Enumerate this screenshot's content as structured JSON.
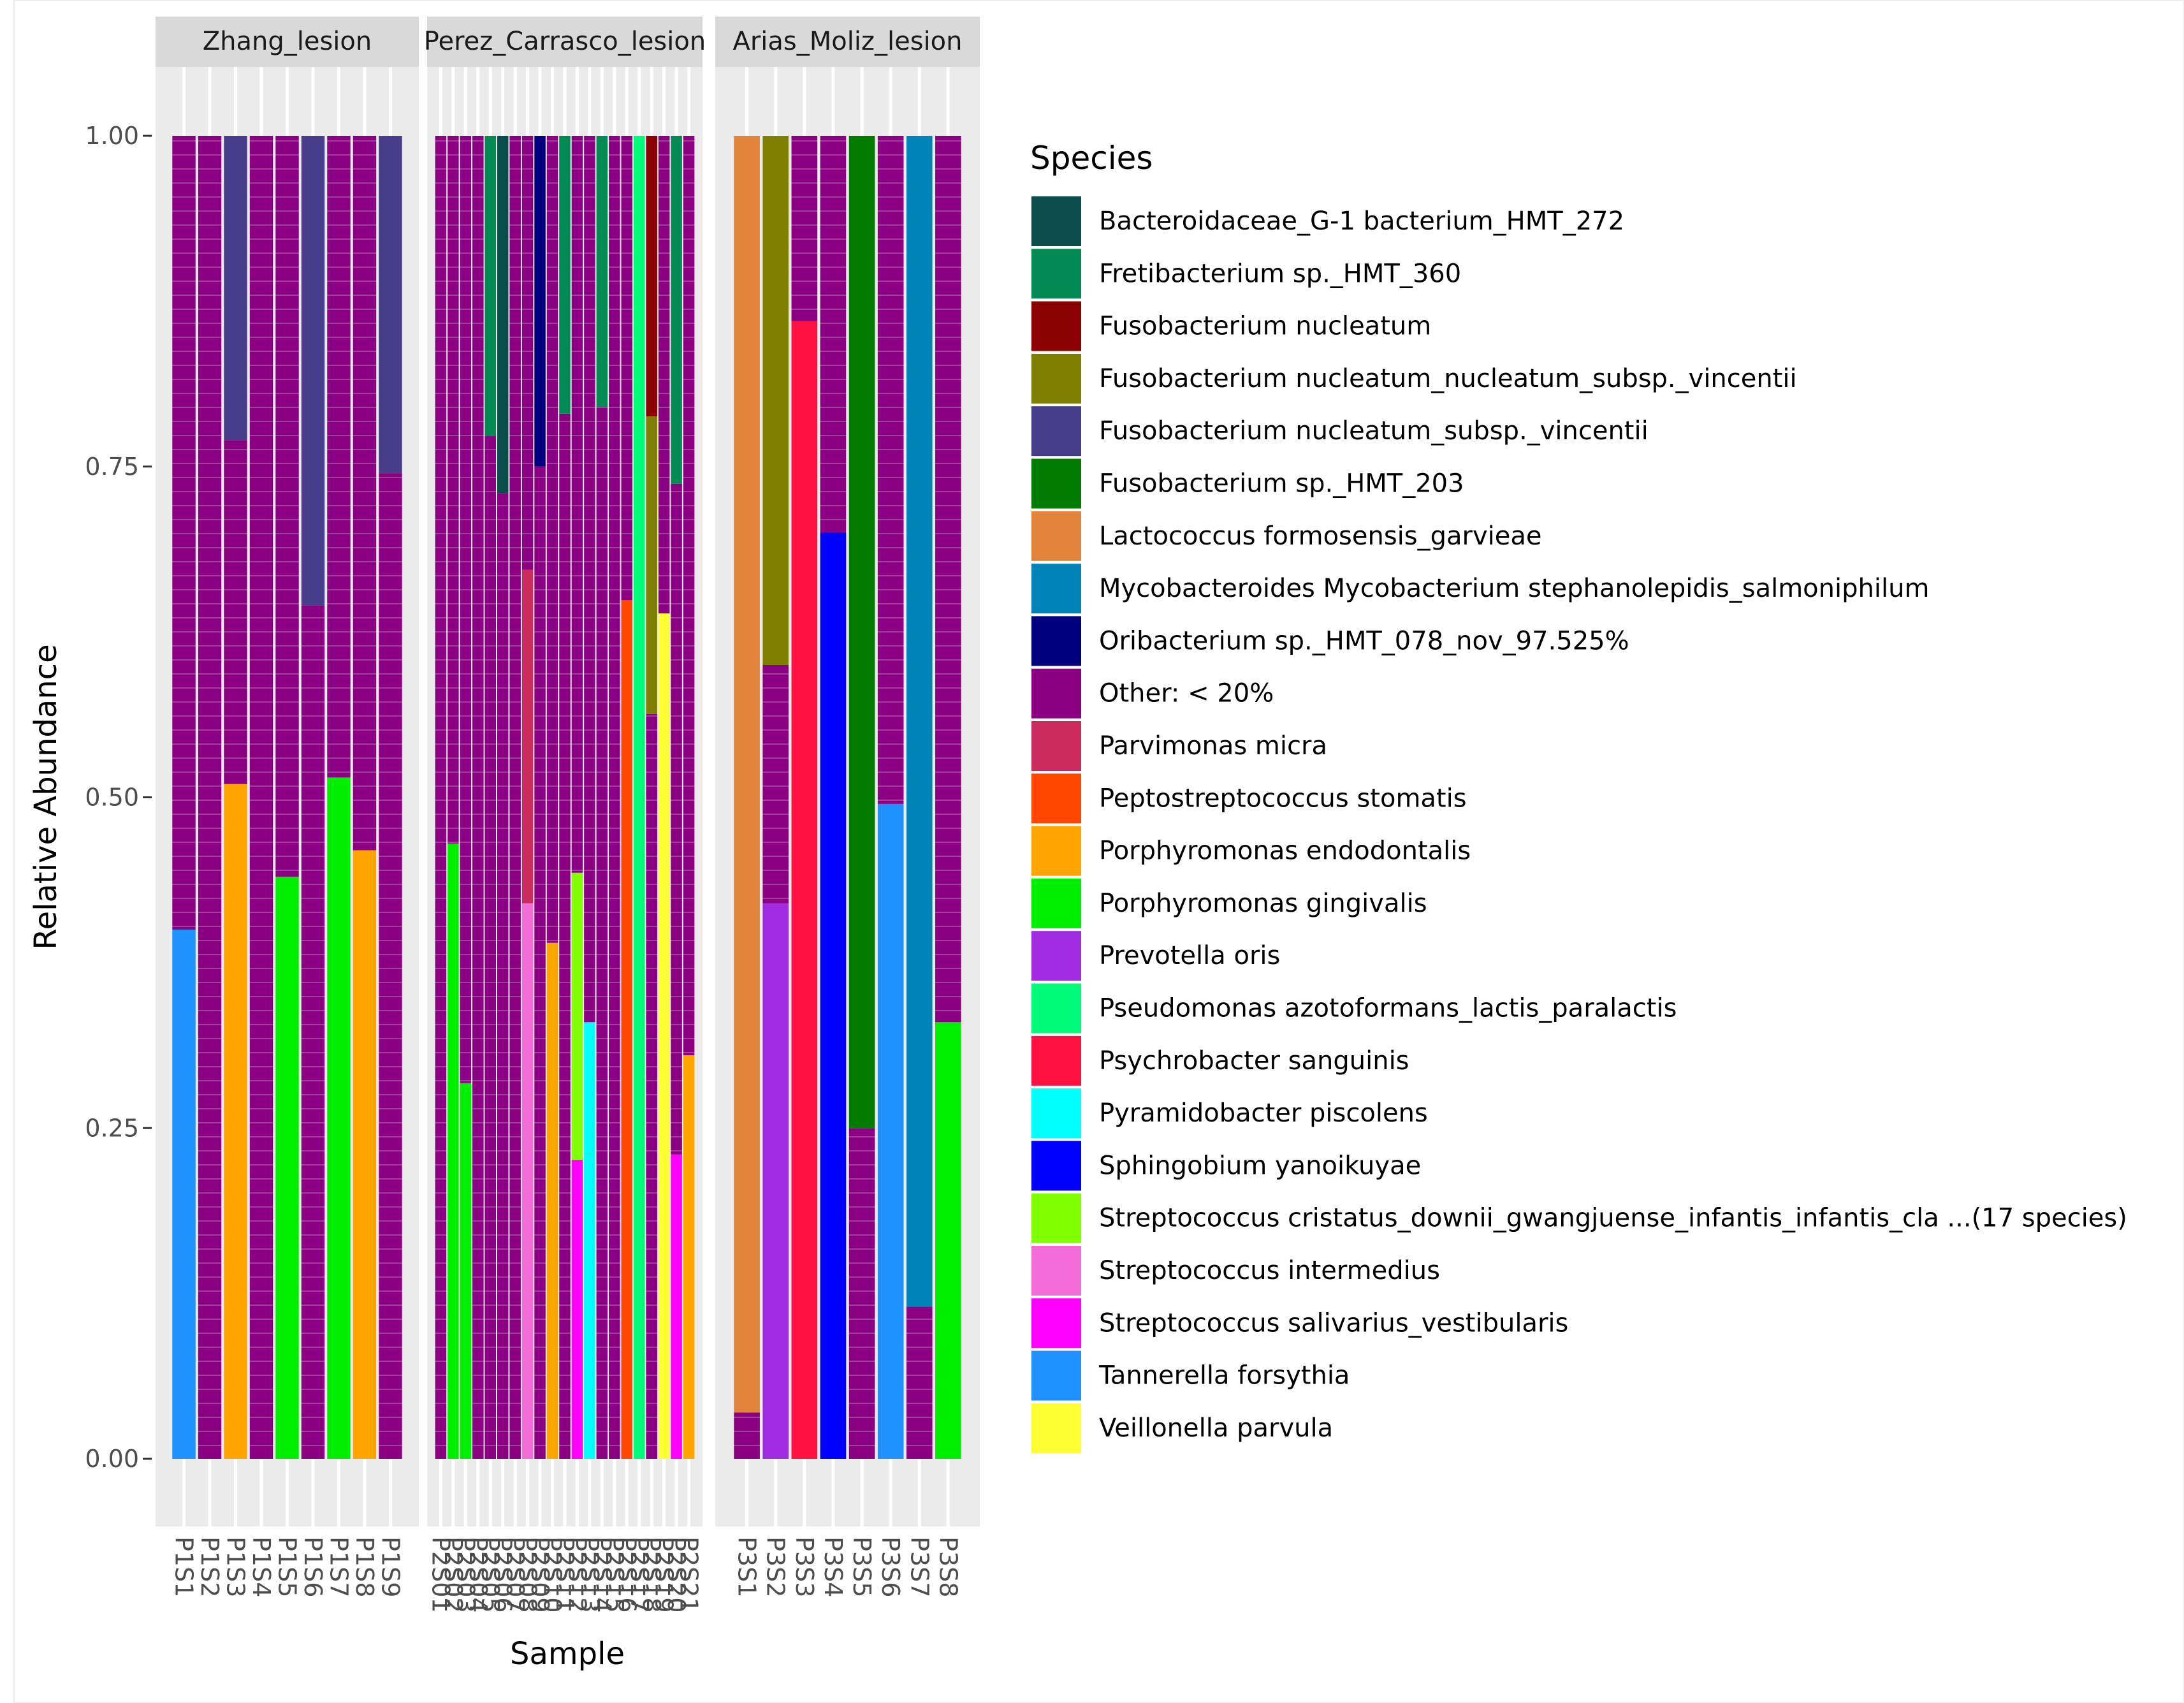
{
  "chart_data": {
    "type": "bar",
    "stacked": true,
    "xlabel": "Sample",
    "ylabel": "Relative Abundance",
    "ylim": [
      0,
      1
    ],
    "yticks": [
      "0.00",
      "0.25",
      "0.50",
      "0.75",
      "1.00"
    ],
    "ytick_values": [
      0,
      0.25,
      0.5,
      0.75,
      1.0
    ],
    "legend": {
      "title": "Species",
      "placement": "right",
      "entries": [
        {
          "name": "Bacteroidaceae_G-1 bacterium_HMT_272",
          "color": "#0B4D4A"
        },
        {
          "name": "Fretibacterium sp._HMT_360",
          "color": "#028A55"
        },
        {
          "name": "Fusobacterium nucleatum",
          "color": "#8B0000"
        },
        {
          "name": "Fusobacterium nucleatum_nucleatum_subsp._vincentii",
          "color": "#808000"
        },
        {
          "name": "Fusobacterium nucleatum_subsp._vincentii",
          "color": "#483D8B"
        },
        {
          "name": "Fusobacterium sp._HMT_203",
          "color": "#007B00"
        },
        {
          "name": "Lactococcus formosensis_garvieae",
          "color": "#E3843C"
        },
        {
          "name": "Mycobacteroides Mycobacterium stephanolepidis_salmoniphilum",
          "color": "#0084B8"
        },
        {
          "name": "Oribacterium sp._HMT_078_nov_97.525%",
          "color": "#00007F"
        },
        {
          "name": "Other: < 20%",
          "color": "#8B0082"
        },
        {
          "name": "Parvimonas micra",
          "color": "#CC2B5E"
        },
        {
          "name": "Peptostreptococcus stomatis",
          "color": "#FF4500"
        },
        {
          "name": "Porphyromonas endodontalis",
          "color": "#FFA500"
        },
        {
          "name": "Porphyromonas gingivalis",
          "color": "#00EE00"
        },
        {
          "name": "Prevotella oris",
          "color": "#A02BE0"
        },
        {
          "name": "Pseudomonas azotoformans_lactis_paralactis",
          "color": "#00FA7A"
        },
        {
          "name": "Psychrobacter sanguinis",
          "color": "#FF1040"
        },
        {
          "name": "Pyramidobacter piscolens",
          "color": "#00FFFF"
        },
        {
          "name": "Sphingobium yanoikuyae",
          "color": "#0000FF"
        },
        {
          "name": "Streptococcus cristatus_downii_gwangjuense_infantis_infantis_cla ...(17 species)",
          "color": "#7FFF00"
        },
        {
          "name": "Streptococcus intermedius",
          "color": "#F46CDA"
        },
        {
          "name": "Streptococcus salivarius_vestibularis",
          "color": "#FF00FF"
        },
        {
          "name": "Tannerella forsythia",
          "color": "#1E90FF"
        },
        {
          "name": "Veillonella parvula",
          "color": "#FFFF33"
        }
      ]
    },
    "panels": [
      {
        "title": "Zhang_lesion",
        "samples": [
          {
            "name": "P1S1",
            "segments": [
              {
                "species": "Tannerella forsythia",
                "value": 0.4
              },
              {
                "species": "Other: < 20%",
                "value": 0.6
              }
            ]
          },
          {
            "name": "P1S2",
            "segments": [
              {
                "species": "Other: < 20%",
                "value": 1.0
              }
            ]
          },
          {
            "name": "P1S3",
            "segments": [
              {
                "species": "Porphyromonas endodontalis",
                "value": 0.51
              },
              {
                "species": "Other: < 20%",
                "value": 0.26
              },
              {
                "species": "Fusobacterium nucleatum_subsp._vincentii",
                "value": 0.23
              }
            ]
          },
          {
            "name": "P1S4",
            "segments": [
              {
                "species": "Other: < 20%",
                "value": 1.0
              }
            ]
          },
          {
            "name": "P1S5",
            "segments": [
              {
                "species": "Porphyromonas gingivalis",
                "value": 0.44
              },
              {
                "species": "Other: < 20%",
                "value": 0.56
              }
            ]
          },
          {
            "name": "P1S6",
            "segments": [
              {
                "species": "Other: < 20%",
                "value": 0.645
              },
              {
                "species": "Fusobacterium nucleatum_subsp._vincentii",
                "value": 0.355
              }
            ]
          },
          {
            "name": "P1S7",
            "segments": [
              {
                "species": "Porphyromonas gingivalis",
                "value": 0.515
              },
              {
                "species": "Other: < 20%",
                "value": 0.485
              }
            ]
          },
          {
            "name": "P1S8",
            "segments": [
              {
                "species": "Porphyromonas endodontalis",
                "value": 0.46
              },
              {
                "species": "Other: < 20%",
                "value": 0.54
              }
            ]
          },
          {
            "name": "P1S9",
            "segments": [
              {
                "species": "Other: < 20%",
                "value": 0.745
              },
              {
                "species": "Fusobacterium nucleatum_subsp._vincentii",
                "value": 0.255
              }
            ]
          }
        ]
      },
      {
        "title": "Perez_Carrasco_lesion",
        "samples": [
          {
            "name": "P2S01",
            "segments": [
              {
                "species": "Other: < 20%",
                "value": 1.0
              }
            ]
          },
          {
            "name": "P2S02",
            "segments": [
              {
                "species": "Porphyromonas gingivalis",
                "value": 0.465
              },
              {
                "species": "Other: < 20%",
                "value": 0.535
              }
            ]
          },
          {
            "name": "P2S03",
            "segments": [
              {
                "species": "Porphyromonas gingivalis",
                "value": 0.284
              },
              {
                "species": "Other: < 20%",
                "value": 0.716
              }
            ]
          },
          {
            "name": "P2S04",
            "segments": [
              {
                "species": "Other: < 20%",
                "value": 1.0
              }
            ]
          },
          {
            "name": "P2S05",
            "segments": [
              {
                "species": "Other: < 20%",
                "value": 0.773
              },
              {
                "species": "Fretibacterium sp._HMT_360",
                "value": 0.227
              }
            ]
          },
          {
            "name": "P2S06",
            "segments": [
              {
                "species": "Other: < 20%",
                "value": 0.73
              },
              {
                "species": "Bacteroidaceae_G-1 bacterium_HMT_272",
                "value": 0.27
              }
            ]
          },
          {
            "name": "P2S07",
            "segments": [
              {
                "species": "Other: < 20%",
                "value": 1.0
              }
            ]
          },
          {
            "name": "P2S08",
            "segments": [
              {
                "species": "Streptococcus intermedius",
                "value": 0.42
              },
              {
                "species": "Parvimonas micra",
                "value": 0.252
              },
              {
                "species": "Other: < 20%",
                "value": 0.328
              }
            ]
          },
          {
            "name": "P2S09",
            "segments": [
              {
                "species": "Other: < 20%",
                "value": 0.75
              },
              {
                "species": "Oribacterium sp._HMT_078_nov_97.525%",
                "value": 0.25
              }
            ]
          },
          {
            "name": "P2S10",
            "segments": [
              {
                "species": "Porphyromonas endodontalis",
                "value": 0.39
              },
              {
                "species": "Other: < 20%",
                "value": 0.61
              }
            ]
          },
          {
            "name": "P2S11",
            "segments": [
              {
                "species": "Other: < 20%",
                "value": 0.79
              },
              {
                "species": "Fretibacterium sp._HMT_360",
                "value": 0.21
              }
            ]
          },
          {
            "name": "P2S12",
            "segments": [
              {
                "species": "Streptococcus salivarius_vestibularis",
                "value": 0.226
              },
              {
                "species": "Streptococcus cristatus_downii_gwangjuense_infantis_infantis_cla ...(17 species)",
                "value": 0.217
              },
              {
                "species": "Other: < 20%",
                "value": 0.557
              }
            ]
          },
          {
            "name": "P2S13",
            "segments": [
              {
                "species": "Pyramidobacter piscolens",
                "value": 0.33
              },
              {
                "species": "Other: < 20%",
                "value": 0.67
              }
            ]
          },
          {
            "name": "P2S14",
            "segments": [
              {
                "species": "Other: < 20%",
                "value": 0.795
              },
              {
                "species": "Fretibacterium sp._HMT_360",
                "value": 0.205
              }
            ]
          },
          {
            "name": "P2S15",
            "segments": [
              {
                "species": "Other: < 20%",
                "value": 1.0
              }
            ]
          },
          {
            "name": "P2S16",
            "segments": [
              {
                "species": "Peptostreptococcus stomatis",
                "value": 0.649
              },
              {
                "species": "Other: < 20%",
                "value": 0.351
              }
            ]
          },
          {
            "name": "P2S17",
            "segments": [
              {
                "species": "Pseudomonas azotoformans_lactis_paralactis",
                "value": 1.0
              }
            ]
          },
          {
            "name": "P2S18",
            "segments": [
              {
                "species": "Other: < 20%",
                "value": 0.563
              },
              {
                "species": "Fusobacterium nucleatum_nucleatum_subsp._vincentii",
                "value": 0.225
              },
              {
                "species": "Fusobacterium nucleatum",
                "value": 0.212
              }
            ]
          },
          {
            "name": "P2S19",
            "segments": [
              {
                "species": "Veillonella parvula",
                "value": 0.639
              },
              {
                "species": "Other: < 20%",
                "value": 0.361
              }
            ]
          },
          {
            "name": "P2S20",
            "segments": [
              {
                "species": "Streptococcus salivarius_vestibularis",
                "value": 0.23
              },
              {
                "species": "Other: < 20%",
                "value": 0.507
              },
              {
                "species": "Fretibacterium sp._HMT_360",
                "value": 0.263
              }
            ]
          },
          {
            "name": "P2S21",
            "segments": [
              {
                "species": "Porphyromonas endodontalis",
                "value": 0.305
              },
              {
                "species": "Other: < 20%",
                "value": 0.695
              }
            ]
          }
        ]
      },
      {
        "title": "Arias_Moliz_lesion",
        "samples": [
          {
            "name": "P3S1",
            "segments": [
              {
                "species": "Other: < 20%",
                "value": 0.035
              },
              {
                "species": "Lactococcus formosensis_garvieae",
                "value": 0.965
              }
            ]
          },
          {
            "name": "P3S2",
            "segments": [
              {
                "species": "Prevotella oris",
                "value": 0.42
              },
              {
                "species": "Other: < 20%",
                "value": 0.18
              },
              {
                "species": "Fusobacterium nucleatum_nucleatum_subsp._vincentii",
                "value": 0.4
              }
            ]
          },
          {
            "name": "P3S3",
            "segments": [
              {
                "species": "Psychrobacter sanguinis",
                "value": 0.86
              },
              {
                "species": "Other: < 20%",
                "value": 0.14
              }
            ]
          },
          {
            "name": "P3S4",
            "segments": [
              {
                "species": "Sphingobium yanoikuyae",
                "value": 0.7
              },
              {
                "species": "Other: < 20%",
                "value": 0.3
              }
            ]
          },
          {
            "name": "P3S5",
            "segments": [
              {
                "species": "Other: < 20%",
                "value": 0.25
              },
              {
                "species": "Fusobacterium sp._HMT_203",
                "value": 0.75
              }
            ]
          },
          {
            "name": "P3S6",
            "segments": [
              {
                "species": "Tannerella forsythia",
                "value": 0.495
              },
              {
                "species": "Other: < 20%",
                "value": 0.505
              }
            ]
          },
          {
            "name": "P3S7",
            "segments": [
              {
                "species": "Other: < 20%",
                "value": 0.115
              },
              {
                "species": "Mycobacteroides Mycobacterium stephanolepidis_salmoniphilum",
                "value": 0.885
              }
            ]
          },
          {
            "name": "P3S8",
            "segments": [
              {
                "species": "Porphyromonas gingivalis",
                "value": 0.33
              },
              {
                "species": "Other: < 20%",
                "value": 0.67
              }
            ]
          }
        ]
      }
    ]
  }
}
